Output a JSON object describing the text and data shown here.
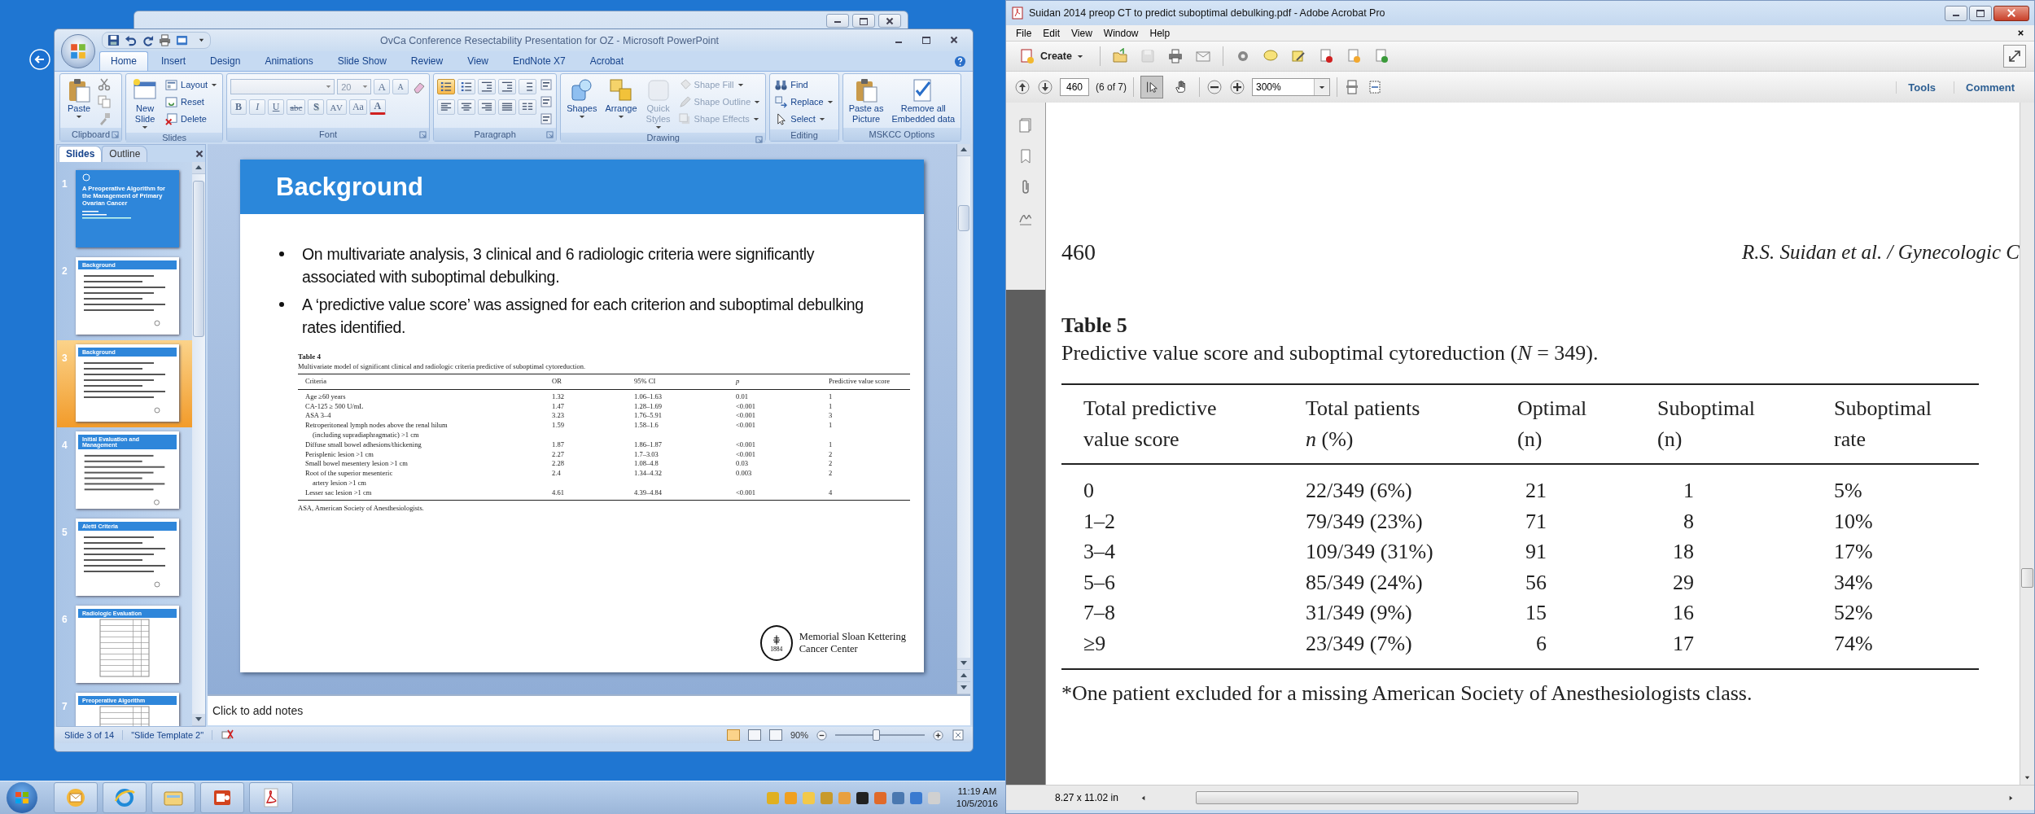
{
  "powerpoint": {
    "title": "OvCa Conference Resectability Presentation for OZ - Microsoft PowerPoint",
    "tabs": [
      {
        "label": "Home",
        "selected": true
      },
      {
        "label": "Insert",
        "selected": false
      },
      {
        "label": "Design",
        "selected": false
      },
      {
        "label": "Animations",
        "selected": false
      },
      {
        "label": "Slide Show",
        "selected": false
      },
      {
        "label": "Review",
        "selected": false
      },
      {
        "label": "View",
        "selected": false
      },
      {
        "label": "EndNote X7",
        "selected": false
      },
      {
        "label": "Acrobat",
        "selected": false
      }
    ],
    "ribbon": [
      {
        "kind": "buttons",
        "label": "Clipboard",
        "launcher": true,
        "large": [
          {
            "lines": [
              "Paste"
            ],
            "dropdown": true,
            "disabled": false
          }
        ]
      },
      {
        "kind": "buttons",
        "label": "Slides",
        "launcher": false,
        "large": [
          {
            "lines": [
              "New",
              "Slide"
            ],
            "dropdown": true,
            "disabled": false
          }
        ],
        "small": [
          {
            "label": "Layout",
            "dropdown": true,
            "disabled": false
          },
          {
            "label": "Reset",
            "dropdown": false,
            "disabled": false
          },
          {
            "label": "Delete",
            "dropdown": false,
            "disabled": false
          }
        ]
      },
      {
        "kind": "font",
        "label": "Font",
        "launcher": true,
        "size": "20",
        "grow": [
          "A",
          "A"
        ],
        "format": [
          "B",
          "I",
          "U",
          "abc",
          "S",
          "AV",
          "Aa",
          "A"
        ]
      },
      {
        "kind": "paragraph",
        "label": "Paragraph",
        "launcher": true,
        "bullets_selected": true
      },
      {
        "kind": "buttons",
        "label": "Drawing",
        "launcher": true,
        "large": [
          {
            "lines": [
              "Shapes"
            ],
            "dropdown": true,
            "disabled": false
          },
          {
            "lines": [
              "Arrange"
            ],
            "dropdown": true,
            "disabled": false
          },
          {
            "lines": [
              "Quick",
              "Styles"
            ],
            "dropdown": true,
            "disabled": true
          }
        ],
        "small": [
          {
            "label": "Shape Fill",
            "dropdown": true,
            "disabled": true
          },
          {
            "label": "Shape Outline",
            "dropdown": true,
            "disabled": true
          },
          {
            "label": "Shape Effects",
            "dropdown": true,
            "disabled": true
          }
        ]
      },
      {
        "kind": "buttons",
        "label": "Editing",
        "launcher": false,
        "small": [
          {
            "label": "Find",
            "dropdown": false,
            "disabled": false
          },
          {
            "label": "Replace",
            "dropdown": true,
            "disabled": false
          },
          {
            "label": "Select",
            "dropdown": true,
            "disabled": false
          }
        ]
      },
      {
        "kind": "buttons",
        "label": "MSKCC Options",
        "launcher": false,
        "large": [
          {
            "lines": [
              "Paste as",
              "Picture"
            ],
            "dropdown": false,
            "disabled": false
          },
          {
            "lines": [
              "Remove all",
              "Embedded data"
            ],
            "dropdown": false,
            "disabled": false
          }
        ]
      }
    ],
    "slides_pane": {
      "tabs": [
        {
          "label": "Slides",
          "selected": true
        },
        {
          "label": "Outline",
          "selected": false
        }
      ],
      "thumbnails": [
        {
          "number": "1",
          "title": "A Preoperative Algorithm for the Management of Primary Ovarian Cancer",
          "kind": "title",
          "selected": false
        },
        {
          "number": "2",
          "title": "Background",
          "kind": "bullets",
          "selected": false
        },
        {
          "number": "3",
          "title": "Background",
          "kind": "bullets",
          "selected": true
        },
        {
          "number": "4",
          "title": "Initial Evaluation and Management",
          "kind": "bullets",
          "selected": false
        },
        {
          "number": "5",
          "title": "Aletti Criteria",
          "kind": "bullets",
          "selected": false
        },
        {
          "number": "6",
          "title": "Radiologic Evaluation",
          "kind": "table",
          "selected": false
        },
        {
          "number": "7",
          "title": "Preoperative Algorithm",
          "kind": "table",
          "selected": false
        }
      ]
    },
    "slide": {
      "title": "Background",
      "bullets": [
        "On multivariate analysis, 3 clinical and 6 radiologic criteria were significantly associated with suboptimal debulking.",
        "A ‘predictive value score’ was assigned for each criterion and suboptimal debulking rates identified."
      ],
      "table": {
        "label": "Table 4",
        "caption": "Multivariate model of significant clinical and radiologic criteria predictive of suboptimal cytoreduction.",
        "columns": [
          {
            "label": "Criteria",
            "italic": false
          },
          {
            "label": "OR",
            "italic": false
          },
          {
            "label": "95% CI",
            "italic": false
          },
          {
            "label": "p",
            "italic": true
          },
          {
            "label": "Predictive value score",
            "italic": false
          }
        ],
        "rows": [
          {
            "criteria": [
              "Age ≥60 years"
            ],
            "values": [
              "1.32",
              "1.06–1.63",
              "0.01",
              "1"
            ]
          },
          {
            "criteria": [
              "CA-125 ≥ 500 U/mL"
            ],
            "values": [
              "1.47",
              "1.28–1.69",
              "<0.001",
              "1"
            ]
          },
          {
            "criteria": [
              "ASA 3–4"
            ],
            "values": [
              "3.23",
              "1.76–5.91",
              "<0.001",
              "3"
            ]
          },
          {
            "criteria": [
              "Retroperitoneal lymph nodes above the renal hilum",
              "(including supradiaphragmatic) >1 cm"
            ],
            "values": [
              "1.59",
              "1.58–1.6",
              "<0.001",
              "1"
            ]
          },
          {
            "criteria": [
              "Diffuse small bowel adhesions/thickening"
            ],
            "values": [
              "1.87",
              "1.86–1.87",
              "<0.001",
              "1"
            ]
          },
          {
            "criteria": [
              "Perisplenic lesion >1 cm"
            ],
            "values": [
              "2.27",
              "1.7–3.03",
              "<0.001",
              "2"
            ]
          },
          {
            "criteria": [
              "Small bowel mesentery lesion >1 cm"
            ],
            "values": [
              "2.28",
              "1.08–4.8",
              "0.03",
              "2"
            ]
          },
          {
            "criteria": [
              "Root of the superior mesenteric",
              "artery lesion >1 cm"
            ],
            "values": [
              "2.4",
              "1.34–4.32",
              "0.003",
              "2"
            ]
          },
          {
            "criteria": [
              "Lesser sac lesion >1 cm"
            ],
            "values": [
              "4.61",
              "4.39–4.84",
              "<0.001",
              "4"
            ]
          }
        ],
        "footnote": "ASA, American Society of Anesthesiologists."
      },
      "logo_year": "1884",
      "logo_text": [
        "Memorial Sloan Kettering",
        "Cancer Center"
      ]
    },
    "notes_placeholder": "Click to add notes",
    "status_bar": {
      "slide": "Slide 3 of 14",
      "template": "\"Slide Template 2\"",
      "views": [
        {
          "selected": true
        },
        {
          "selected": false
        },
        {
          "selected": false
        }
      ],
      "zoom": {
        "reading": "90%",
        "level": 0.45
      }
    }
  },
  "acrobat": {
    "title": "Suidan 2014 preop CT to predict suboptimal debulking.pdf - Adobe Acrobat Pro",
    "menu": [
      "File",
      "Edit",
      "View",
      "Window",
      "Help"
    ],
    "create": "Create",
    "save_disabled": true,
    "page": "460",
    "page_count": "(6 of 7)",
    "tools": [
      {
        "selected": true
      },
      {
        "selected": false
      }
    ],
    "zoom": "300%",
    "panels": [
      "Tools",
      "Comment"
    ],
    "document": {
      "page_number": "460",
      "running_head": "R.S. Suidan et al. / Gynecologic C",
      "table_label": "Table 5",
      "caption": "Predictive value score and suboptimal cytoreduction (*N* = 349).",
      "columns": [
        {
          "lines": [
            "Total predictive",
            "value score"
          ]
        },
        {
          "lines": [
            "Total patients",
            "*n* (%)"
          ]
        },
        {
          "lines": [
            "Optimal",
            "(n)"
          ]
        },
        {
          "lines": [
            "Suboptimal",
            "(n)"
          ]
        },
        {
          "lines": [
            "Suboptimal",
            "rate"
          ]
        }
      ],
      "rows": [
        [
          "0",
          "22/349 (6%)",
          "21",
          "1",
          "5%"
        ],
        [
          "1–2",
          "79/349 (23%)",
          "71",
          "8",
          "10%"
        ],
        [
          "3–4",
          "109/349 (31%)",
          "91",
          "18",
          "17%"
        ],
        [
          "5–6",
          "85/349 (24%)",
          "56",
          "29",
          "34%"
        ],
        [
          "7–8",
          "31/349 (9%)",
          "15",
          "16",
          "52%"
        ],
        [
          "≥9",
          "23/349 (7%)",
          "6",
          "17",
          "74%"
        ]
      ],
      "footnote": "*One patient excluded for a missing American Society of Anesthesiologists class."
    },
    "page_size": "8.27 x 11.02 in"
  },
  "taskbar": {
    "time": "11:19 AM",
    "date": "10/5/2016"
  }
}
